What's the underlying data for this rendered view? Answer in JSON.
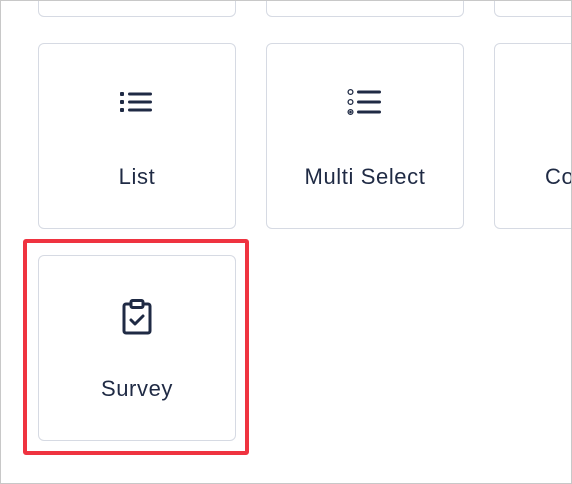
{
  "cards": {
    "list": {
      "label": "List",
      "icon": "list-icon"
    },
    "multi_select": {
      "label": "Multi Select",
      "icon": "multi-select-icon"
    },
    "third": {
      "label": "Co",
      "icon": ""
    },
    "survey": {
      "label": "Survey",
      "icon": "clipboard-check-icon"
    }
  },
  "colors": {
    "highlight": "#ef3340",
    "card_border": "#d6dae3",
    "text": "#1f2a44"
  }
}
